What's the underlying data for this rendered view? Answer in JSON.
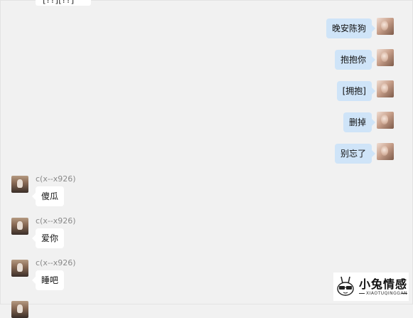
{
  "chat": {
    "partial_top_message": "[??][??]",
    "sent_messages": [
      {
        "text": "晚安陈狗"
      },
      {
        "text": "抱抱你"
      },
      {
        "text": "[拥抱]"
      },
      {
        "text": "删掉"
      },
      {
        "text": "别忘了"
      }
    ],
    "received_messages": [
      {
        "sender": "c(x--x926)",
        "text": "傻瓜"
      },
      {
        "sender": "c(x--x926)",
        "text": "爱你"
      },
      {
        "sender": "c(x--x926)",
        "text": "睡吧"
      }
    ]
  },
  "watermark": {
    "title": "小兔情感",
    "subtitle": "XIAOTUQINGGAN"
  }
}
